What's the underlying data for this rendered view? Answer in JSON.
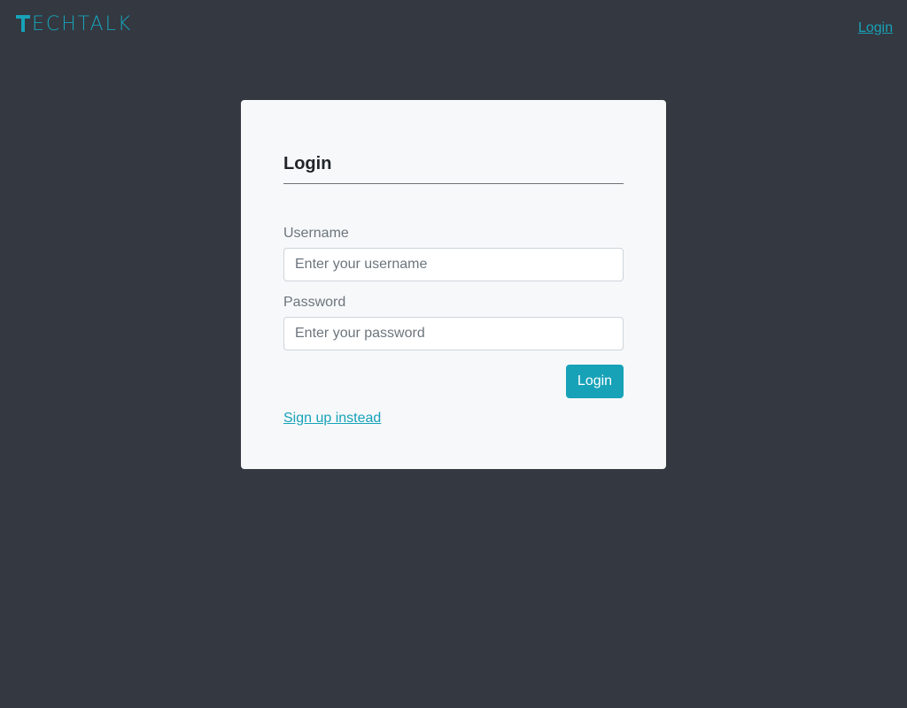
{
  "header": {
    "logo_text": "ECHTALK",
    "login_link": "Login"
  },
  "login_card": {
    "title": "Login",
    "username": {
      "label": "Username",
      "placeholder": "Enter your username",
      "value": ""
    },
    "password": {
      "label": "Password",
      "placeholder": "Enter your password",
      "value": ""
    },
    "submit_label": "Login",
    "signup_link": "Sign up instead"
  },
  "colors": {
    "background": "#343840",
    "accent": "#17a2b8",
    "card_background": "#f7f8fa"
  }
}
